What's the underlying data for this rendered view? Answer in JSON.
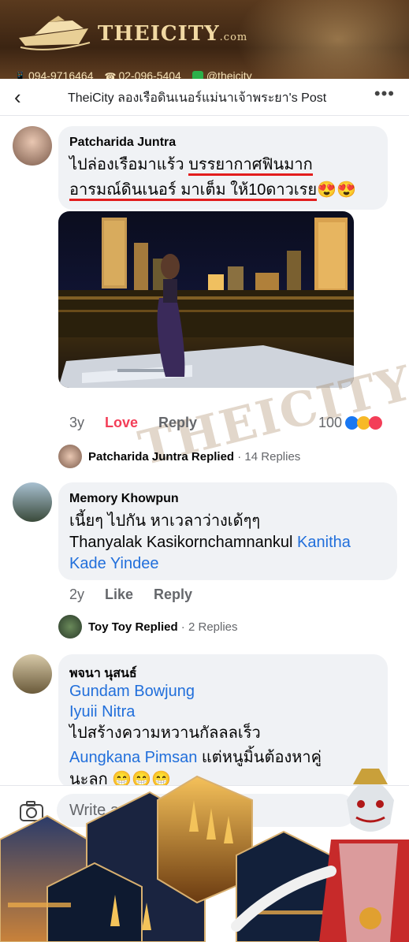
{
  "banner": {
    "brand_name": "THEICITY",
    "brand_suffix": ".com",
    "phone_mobile": "094-9716464",
    "phone_office": "02-096-5404",
    "line_id": "@theicity"
  },
  "header": {
    "back_icon": "chevron-left-icon",
    "title": "TheiCity ลองเรือดินเนอร์แม่นาเจ้าพระยา's Post",
    "more_icon": "more-horizontal-icon"
  },
  "comments": [
    {
      "author": "Patcharida Juntra",
      "text_line1_a": "ไปล่องเรือมาแร้ว ",
      "text_line1_b": "บรรยากาศฟินมาก",
      "text_line2_a": "อารมณ์ดินเนอร์ มาเต็ม ให้10ดาวเรย",
      "text_line2_emoji": "😍😍",
      "age": "3y",
      "reaction_label": "Love",
      "reply_label": "Reply",
      "reaction_count": "100",
      "reply_author": "Patcharida Juntra",
      "reply_verb": "Replied",
      "reply_count": "14 Replies"
    },
    {
      "author": "Memory Khowpun",
      "text_line1": "เนี้ยๆ ไปกัน หาเวลาว่างเด้ๆๆ",
      "text_line2_a": "Thanyalak Kasikornchamnankul ",
      "text_line2_link": "Kanitha",
      "text_line3_link": "Kade Yindee",
      "age": "2y",
      "like_label": "Like",
      "reply_label": "Reply",
      "reply_author": "Toy Toy",
      "reply_verb": "Replied",
      "reply_count": "2 Replies"
    },
    {
      "author": "พจนา นุสนธ์",
      "link1": "Gundam Bowjung",
      "link2": "Iyuii Nitra",
      "text_line3": "ไปสร้างความหวานกัลลลเร็ว",
      "link4": "Aungkana Pimsan",
      "text_line4_rest": " แต่หนูมิ้นต้องหาคู่",
      "text_line5": "นะลูก 😁😁😁"
    }
  ],
  "composer": {
    "camera_icon": "camera-icon",
    "placeholder": "Write a co"
  },
  "colors": {
    "love": "#f33e58",
    "link": "#216fdb",
    "underline": "#e21d1d",
    "bubble": "#f0f2f5"
  }
}
